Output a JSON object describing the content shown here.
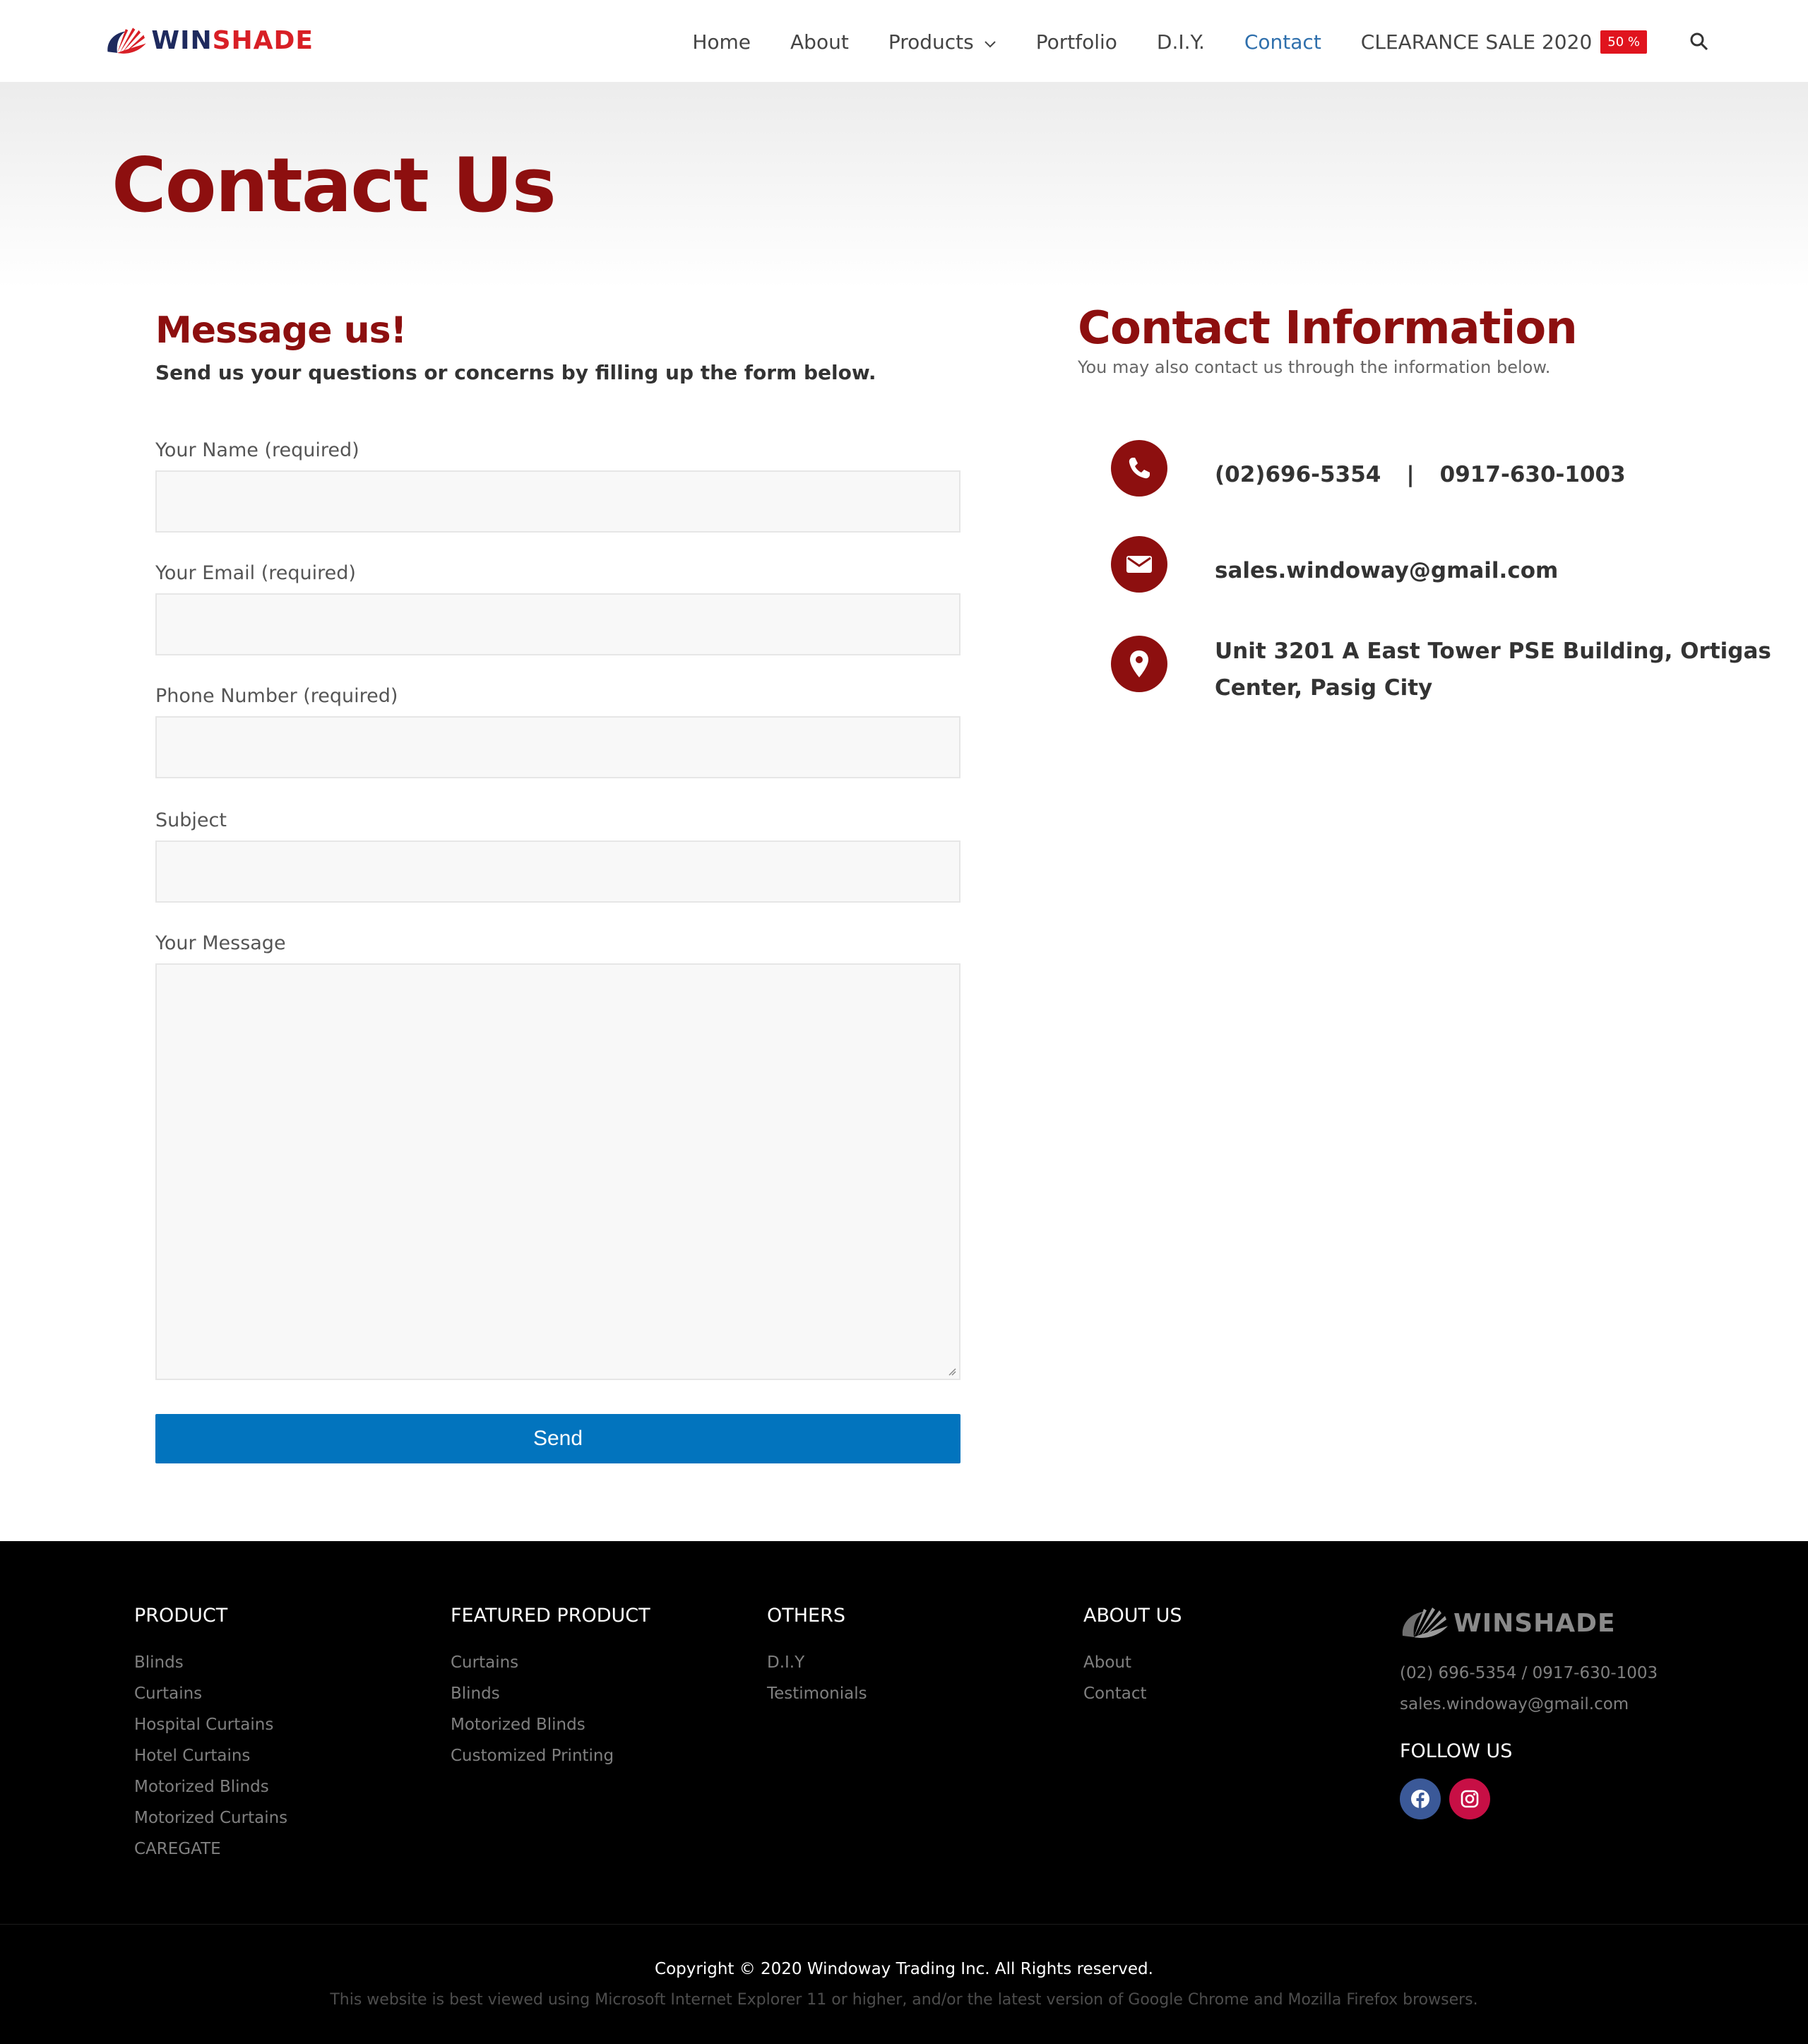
{
  "colors": {
    "brand_red": "#8d0f0f",
    "accent_blue": "#0274be",
    "nav_active": "#2e6fac",
    "sale_badge": "#e0141e",
    "footer_bg": "#000000"
  },
  "header": {
    "logo": {
      "part1": "WIN",
      "part2": "SHADE",
      "icon": "winshade-logo-icon"
    },
    "nav": {
      "home": "Home",
      "about": "About",
      "products": "Products",
      "portfolio": "Portfolio",
      "diy": "D.I.Y.",
      "contact": "Contact",
      "clearance": "CLEARANCE SALE 2020",
      "clearance_badge": "50 %"
    },
    "icons": {
      "products_dropdown": "chevron-down-icon",
      "search": "search-icon"
    }
  },
  "hero": {
    "title": "Contact Us"
  },
  "form": {
    "heading": "Message us!",
    "subheading": "Send us your questions or concerns by filling up the form below.",
    "fields": {
      "name_label": "Your Name (required)",
      "name_value": "",
      "email_label": "Your Email (required)",
      "email_value": "",
      "phone_label": "Phone Number (required)",
      "phone_value": "",
      "subject_label": "Subject",
      "subject_value": "",
      "message_label": "Your Message",
      "message_value": ""
    },
    "send_label": "Send"
  },
  "contact_info": {
    "heading": "Contact Information",
    "subheading": "You may also contact us through the information below.",
    "phone1": "(02)696-5354",
    "separator": "|",
    "phone2": "0917-630-1003",
    "email": "sales.windoway@gmail.com",
    "address_line1": "Unit 3201 A East Tower PSE Building, Ortigas",
    "address_line2": "Center, Pasig City",
    "icons": {
      "phone": "phone-icon",
      "email": "envelope-icon",
      "address": "map-pin-icon"
    }
  },
  "footer": {
    "product": {
      "title": "PRODUCT",
      "links": [
        "Blinds",
        "Curtains",
        "Hospital Curtains",
        "Hotel Curtains",
        "Motorized Blinds",
        "Motorized Curtains",
        "CAREGATE"
      ]
    },
    "featured": {
      "title": "FEATURED PRODUCT",
      "links": [
        "Curtains",
        "Blinds",
        "Motorized Blinds",
        "Customized Printing"
      ]
    },
    "others": {
      "title": "OTHERS",
      "links": [
        "D.I.Y",
        "Testimonials"
      ]
    },
    "about": {
      "title": "ABOUT US",
      "links": [
        "About",
        "Contact"
      ]
    },
    "logo": {
      "text": "WINSHADE"
    },
    "phone": "(02) 696-5354 / 0917-630-1003",
    "email": "sales.windoway@gmail.com",
    "follow_title": "FOLLOW US",
    "social_icons": [
      "facebook-icon",
      "instagram-icon"
    ],
    "copyright": "Copyright © 2020 Windoway Trading Inc. All Rights reserved.",
    "browser_note": "This website is best viewed using Microsoft Internet Explorer 11 or higher, and/or the latest version of Google Chrome and Mozilla Firefox browsers."
  }
}
